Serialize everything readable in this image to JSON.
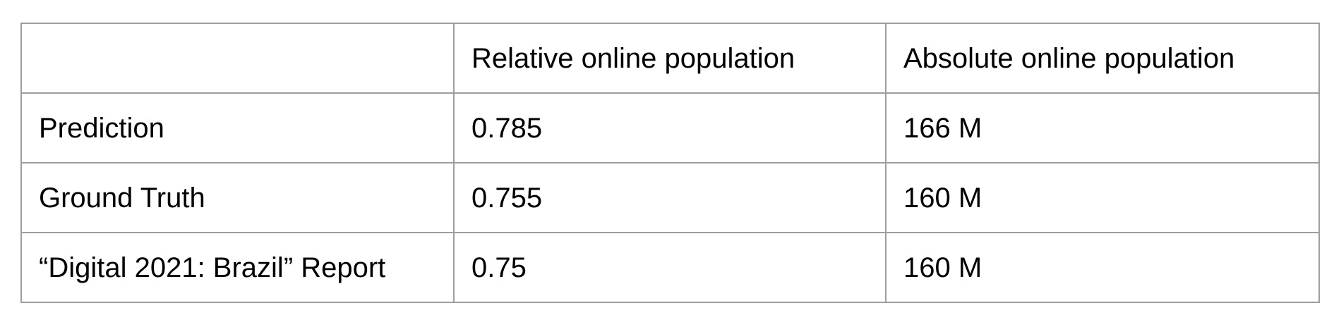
{
  "table": {
    "headers": [
      "",
      "Relative online population",
      "Absolute online population"
    ],
    "rows": [
      {
        "label": "Prediction",
        "relative": "0.785",
        "absolute": "166 M"
      },
      {
        "label": "Ground Truth",
        "relative": "0.755",
        "absolute": "160 M"
      },
      {
        "label": "“Digital 2021: Brazil” Report",
        "relative": "0.75",
        "absolute": "160 M"
      }
    ]
  }
}
